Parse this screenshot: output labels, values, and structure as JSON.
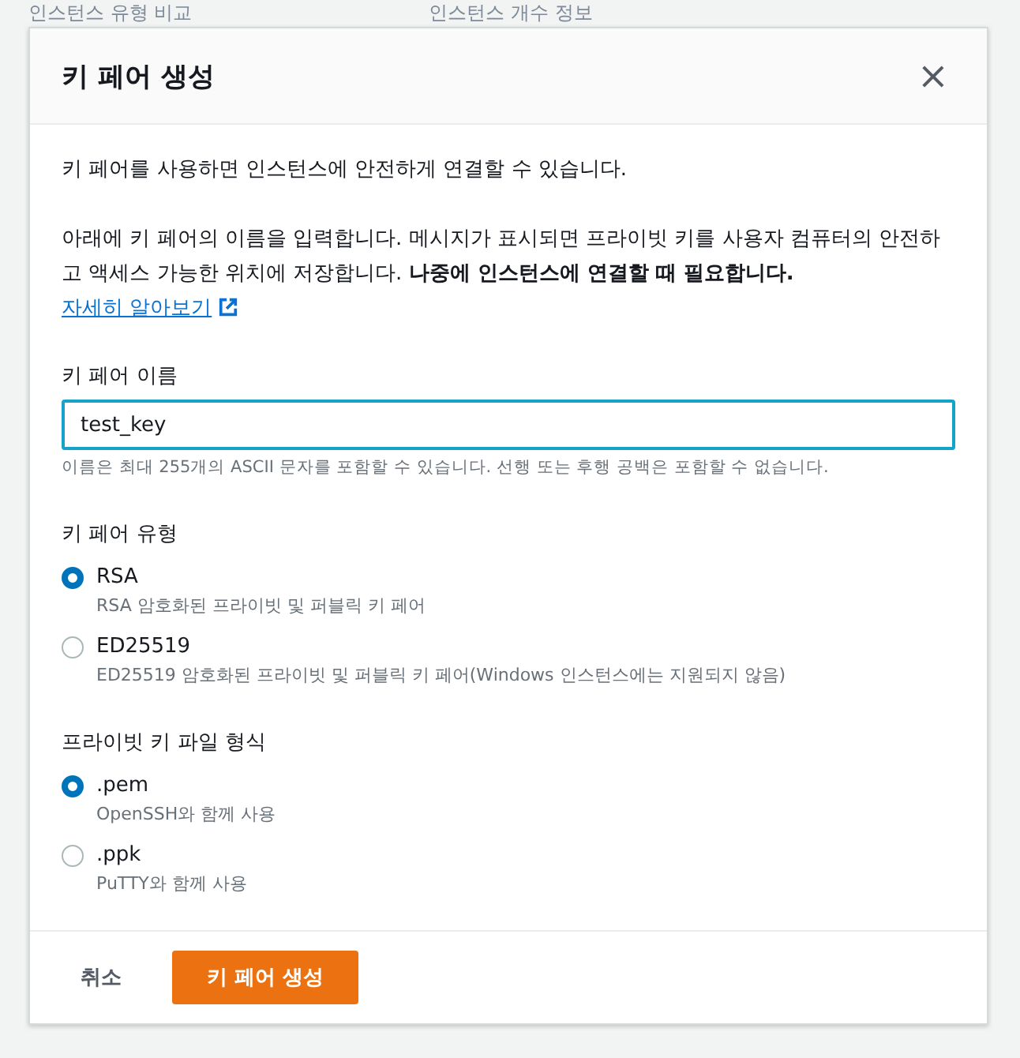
{
  "background": {
    "headings": [
      "인스턴스 유형 비교",
      "인스턴스 개수 정보"
    ]
  },
  "dialog": {
    "title": "키 페어 생성",
    "close_icon": "×",
    "intro": "키 페어를 사용하면 인스턴스에 안전하게 연결할 수 있습니다.",
    "description": "아래에 키 페어의 이름을 입력합니다. 메시지가 표시되면 프라이빗 키를 사용자 컴퓨터의 안전하고 액세스 가능한 위치에 저장합니다. **나중에 인스턴스에 연결할 때 필요합니다.**",
    "link": "자세히 알아보기",
    "name_field": {
      "label": "키 페어 이름",
      "value": "test_key",
      "hint": "이름은 최대 255개의 ASCII 문자를 포함할 수 있습니다. 선행 또는 후행 공백은 포함할 수 없습니다."
    },
    "groups": [
      {
        "label": "키 페어 유형",
        "options": [
          {
            "label": "RSA",
            "description": "RSA 암호화된 프라이빗 및 퍼블릭 키 페어",
            "selected": true
          },
          {
            "label": "ED25519",
            "description": "ED25519 암호화된 프라이빗 및 퍼블릭 키 페어(Windows 인스턴스에는 지원되지 않음)",
            "selected": false
          }
        ]
      },
      {
        "label": "프라이빗 키 파일 형식",
        "options": [
          {
            "label": ".pem",
            "description": "OpenSSH와 함께 사용",
            "selected": true
          },
          {
            "label": ".ppk",
            "description": "PuTTY와 함께 사용",
            "selected": false
          }
        ]
      }
    ],
    "buttons": [
      {
        "label": "취소",
        "kind": "link"
      },
      {
        "label": "키 페어 생성",
        "kind": "primary"
      }
    ]
  }
}
